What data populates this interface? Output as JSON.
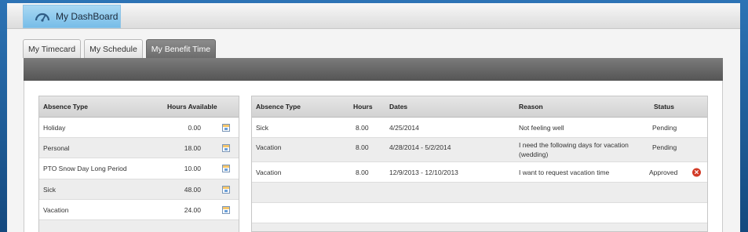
{
  "header": {
    "dashboard_label": "My DashBoard"
  },
  "tabs": [
    {
      "label": "My Timecard"
    },
    {
      "label": "My Schedule"
    },
    {
      "label": "My Benefit Time"
    }
  ],
  "balances": {
    "headers": {
      "absence_type": "Absence Type",
      "hours_available": "Hours Available"
    },
    "rows": [
      {
        "type": "Holiday",
        "hours": "0.00",
        "icon": "calendar-icon"
      },
      {
        "type": "Personal",
        "hours": "18.00",
        "icon": "calendar-icon"
      },
      {
        "type": "PTO Snow Day Long Period",
        "hours": "10.00",
        "icon": "calendar-icon"
      },
      {
        "type": "Sick",
        "hours": "48.00",
        "icon": "calendar-icon"
      },
      {
        "type": "Vacation",
        "hours": "24.00",
        "icon": "calendar-icon"
      }
    ]
  },
  "requests": {
    "headers": {
      "absence_type": "Absence Type",
      "hours": "Hours",
      "dates": "Dates",
      "reason": "Reason",
      "status": "Status"
    },
    "rows": [
      {
        "type": "Sick",
        "hours": "8.00",
        "dates": "4/25/2014",
        "reason": "Not feeling well",
        "status": "Pending"
      },
      {
        "type": "Vacation",
        "hours": "8.00",
        "dates": "4/28/2014 - 5/2/2014",
        "reason": "I need the following days for vacation (wedding)",
        "status": "Pending"
      },
      {
        "type": "Vacation",
        "hours": "8.00",
        "dates": "12/9/2013 - 12/10/2013",
        "reason": "I want to request vacation time",
        "status": "Approved",
        "icon": "cancel-icon"
      }
    ]
  },
  "colors": {
    "accent": "#77bde8",
    "active_tab": "#7a7a7a",
    "cancel": "#d23b27"
  }
}
